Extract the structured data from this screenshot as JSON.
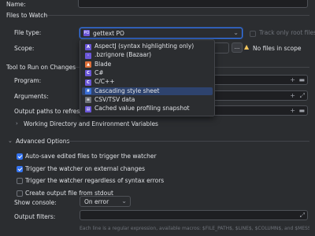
{
  "name_label": "Name:",
  "files_to_watch": {
    "header": "Files to Watch",
    "file_type_label": "File type:",
    "file_type_value": "gettext PO",
    "track_only_root": "Track only root files",
    "scope_label": "Scope:",
    "scope_more": "...",
    "no_files_warning": "No files in scope"
  },
  "popup": {
    "items": [
      {
        "label": "AspectJ (syntax highlighting only)",
        "icon": "aspectj-icon",
        "color": "#6b57d9",
        "glyph": "A"
      },
      {
        "label": ".bzrignore (Bazaar)",
        "icon": "ignore-file-icon",
        "color": "#6b57d9",
        "glyph": "·"
      },
      {
        "label": "Blade",
        "icon": "blade-icon",
        "color": "#e0703a",
        "glyph": "▲"
      },
      {
        "label": "C#",
        "icon": "csharp-icon",
        "color": "#6b57d9",
        "glyph": "C"
      },
      {
        "label": "C/C++",
        "icon": "cpp-icon",
        "color": "#6b57d9",
        "glyph": "C"
      },
      {
        "label": "Cascading style sheet",
        "icon": "css-icon",
        "color": "#3b6fd6",
        "glyph": "#"
      },
      {
        "label": "CSV/TSV data",
        "icon": "csv-icon",
        "color": "#6f737a",
        "glyph": "≡"
      },
      {
        "label": "Cached value profiling snapshot",
        "icon": "snapshot-icon",
        "color": "#6b57d9",
        "glyph": "▤"
      }
    ],
    "selected_index": 5
  },
  "tool": {
    "header": "Tool to Run on Changes",
    "program_label": "Program:",
    "arguments_label": "Arguments:",
    "output_paths_label": "Output paths to refresh:",
    "working_dir_label": "Working Directory and Environment Variables"
  },
  "advanced": {
    "header": "Advanced Options",
    "options": [
      {
        "label": "Auto-save edited files to trigger the watcher",
        "checked": true
      },
      {
        "label": "Trigger the watcher on external changes",
        "checked": true
      },
      {
        "label": "Trigger the watcher regardless of syntax errors",
        "checked": false
      },
      {
        "label": "Create output file from stdout",
        "checked": false
      }
    ],
    "show_console_label": "Show console:",
    "show_console_value": "On error",
    "output_filters_label": "Output filters:",
    "hint": "Each line is a regular expression, available macros: $FILE_PATH$, $LINE$, $COLUMN$, and $MESSAGE$"
  }
}
